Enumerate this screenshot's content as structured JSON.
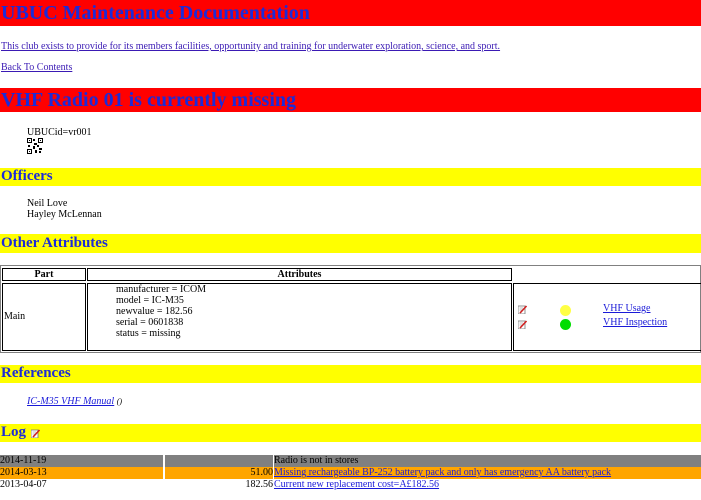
{
  "header": {
    "title": "UBUC Maintenance Documentation",
    "club_statement": "This club exists to provide for its members facilities, opportunity and training for underwater exploration, science, and sport.",
    "back_link": "Back To Contents"
  },
  "item": {
    "title": "VHF Radio 01 is currently missing",
    "ubucid": "UBUCid=vr001"
  },
  "officers": {
    "heading": "Officers",
    "names": [
      "Neil Love",
      "Hayley McLennan"
    ]
  },
  "attributes": {
    "heading": "Other Attributes",
    "col_part": "Part",
    "col_attributes": "Attributes",
    "part": "Main",
    "lines": [
      "manufacturer = ICOM",
      "model = IC-M35",
      "newvalue = 182.56",
      "serial = 0601838",
      "status = missing"
    ],
    "links": [
      {
        "label": "VHF Usage",
        "status_color": "#ffff44"
      },
      {
        "label": "VHF Inspection",
        "status_color": "#00dd00"
      }
    ]
  },
  "references": {
    "heading": "References",
    "manual_link": "IC-M35 VHF Manual",
    "manual_suffix": "()"
  },
  "log": {
    "heading": "Log",
    "rows": [
      {
        "date": "2014-11-19",
        "amount": "",
        "text": "Radio is not in stores",
        "bg": "#808080",
        "is_link": false
      },
      {
        "date": "2014-03-13",
        "amount": "51.00",
        "text": "Missing rechargeable BP-252 battery pack and only has emergency AA battery pack",
        "bg": "#ffa500",
        "is_link": true
      },
      {
        "date": "2013-04-07",
        "amount": "182.56",
        "text": "Current new replacement cost=A£182.56",
        "bg": "#ffffff",
        "is_link": true
      }
    ]
  }
}
